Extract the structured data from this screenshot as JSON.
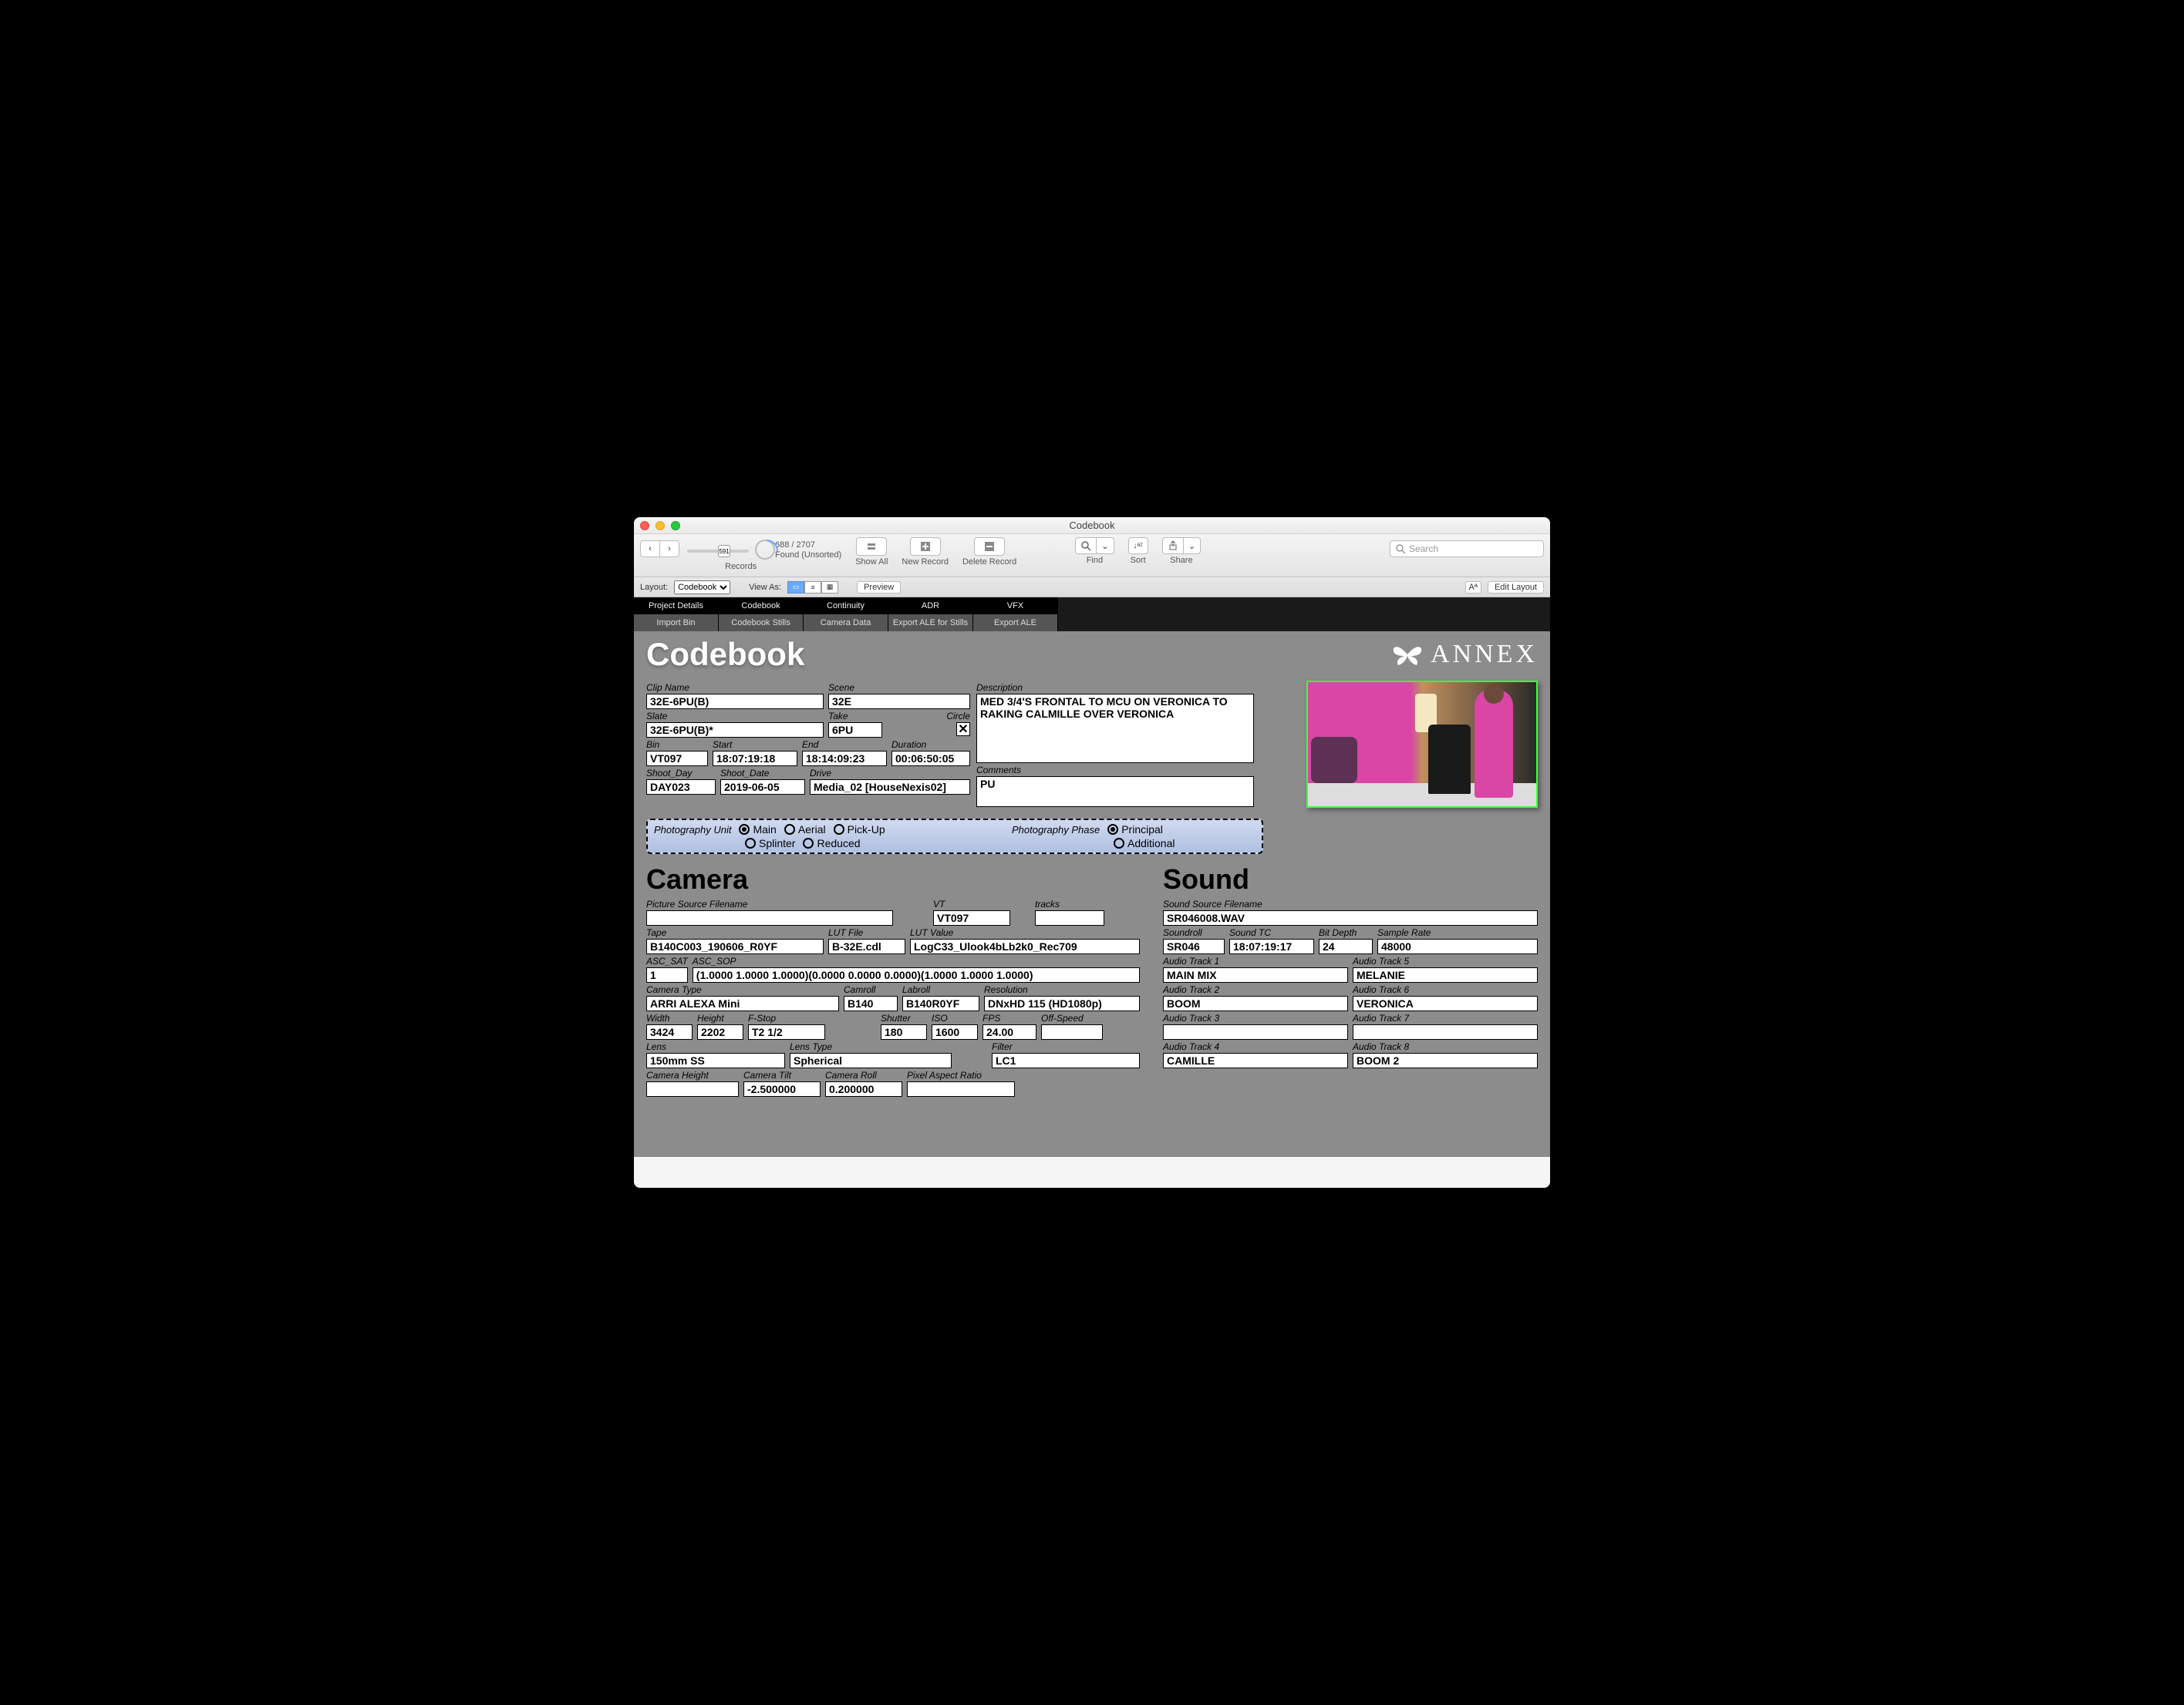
{
  "window": {
    "title": "Codebook"
  },
  "toolbar": {
    "nav_prev": "‹",
    "nav_next": "›",
    "slider_value": "591",
    "found_count": "688 / 2707",
    "found_status": "Found (Unsorted)",
    "records_label": "Records",
    "show_all": "Show All",
    "new_record": "New Record",
    "delete_record": "Delete Record",
    "find": "Find",
    "sort": "Sort",
    "share": "Share",
    "search_placeholder": "Search"
  },
  "layoutbar": {
    "layout_label": "Layout:",
    "layout_value": "Codebook",
    "viewas_label": "View As:",
    "preview": "Preview",
    "aa": "Aª",
    "edit_layout": "Edit Layout"
  },
  "tabs_primary": [
    "Project Details",
    "Codebook",
    "Continuity",
    "ADR",
    "VFX"
  ],
  "tabs_secondary": [
    "Import Bin",
    "Codebook Stills",
    "Camera Data",
    "Export ALE for Stills",
    "Export ALE"
  ],
  "header": {
    "title": "Codebook",
    "brand": "ANNEX"
  },
  "clip": {
    "clip_name_label": "Clip Name",
    "clip_name": "32E-6PU(B)",
    "scene_label": "Scene",
    "scene": "32E",
    "slate_label": "Slate",
    "slate": "32E-6PU(B)*",
    "take_label": "Take",
    "take": "6PU",
    "circle_label": "Circle",
    "circle_checked": "✕",
    "bin_label": "Bin",
    "bin": "VT097",
    "start_label": "Start",
    "start": "18:07:19:18",
    "end_label": "End",
    "end": "18:14:09:23",
    "duration_label": "Duration",
    "duration": "00:06:50:05",
    "shoot_day_label": "Shoot_Day",
    "shoot_day": "DAY023",
    "shoot_date_label": "Shoot_Date",
    "shoot_date": "2019-06-05",
    "drive_label": "Drive",
    "drive": "Media_02 [HouseNexis02]",
    "description_label": "Description",
    "description": "MED 3/4'S FRONTAL TO MCU ON VERONICA TO RAKING CALMILLE OVER VERONICA",
    "comments_label": "Comments",
    "comments": "PU"
  },
  "radios": {
    "unit_label": "Photography Unit",
    "unit_options": [
      "Main",
      "Aerial",
      "Pick-Up",
      "Splinter",
      "Reduced"
    ],
    "unit_selected": "Main",
    "phase_label": "Photography Phase",
    "phase_options": [
      "Principal",
      "Additional"
    ],
    "phase_selected": "Principal"
  },
  "camera": {
    "heading": "Camera",
    "psf_label": "Picture Source Filename",
    "psf": "",
    "vt_label": "VT",
    "vt": "VT097",
    "tracks_label": "tracks",
    "tracks": "",
    "tape_label": "Tape",
    "tape": "B140C003_190606_R0YF",
    "lutfile_label": "LUT File",
    "lutfile": "B-32E.cdl",
    "lutvalue_label": "LUT Value",
    "lutvalue": "LogC33_Ulook4bLb2k0_Rec709",
    "ascsat_label": "ASC_SAT",
    "ascsat": "1",
    "ascsop_label": "ASC_SOP",
    "ascsop": "(1.0000 1.0000 1.0000)(0.0000 0.0000 0.0000)(1.0000 1.0000 1.0000)",
    "camtype_label": "Camera Type",
    "camtype": "ARRI ALEXA Mini",
    "camroll_label": "Camroll",
    "camroll": "B140",
    "labroll_label": "Labroll",
    "labroll": "B140R0YF",
    "res_label": "Resolution",
    "res": "DNxHD 115 (HD1080p)",
    "width_label": "Width",
    "width": "3424",
    "height_label": "Height",
    "height": "2202",
    "fstop_label": "F-Stop",
    "fstop": "T2 1/2",
    "shutter_label": "Shutter",
    "shutter": "180",
    "iso_label": "ISO",
    "iso": "1600",
    "fps_label": "FPS",
    "fps": "24.00",
    "offspeed_label": "Off-Speed",
    "offspeed": "",
    "lens_label": "Lens",
    "lens": "150mm SS",
    "lenstype_label": "Lens Type",
    "lenstype": "Spherical",
    "filter_label": "Filter",
    "filter": "LC1",
    "camheight_label": "Camera Height",
    "camheight": "",
    "camtilt_label": "Camera Tilt",
    "camtilt": "-2.500000",
    "camroll2_label": "Camera Roll",
    "camroll2": "0.200000",
    "par_label": "Pixel Aspect Ratio",
    "par": ""
  },
  "sound": {
    "heading": "Sound",
    "ssf_label": "Sound Source Filename",
    "ssf": "SR046008.WAV",
    "soundroll_label": "Soundroll",
    "soundroll": "SR046",
    "soundtc_label": "Sound TC",
    "soundtc": "18:07:19:17",
    "bitdepth_label": "Bit Depth",
    "bitdepth": "24",
    "samplerate_label": "Sample Rate",
    "samplerate": "48000",
    "t1_label": "Audio Track 1",
    "t1": "MAIN MIX",
    "t2_label": "Audio Track 2",
    "t2": "BOOM",
    "t3_label": "Audio Track 3",
    "t3": "",
    "t4_label": "Audio Track 4",
    "t4": "CAMILLE",
    "t5_label": "Audio Track 5",
    "t5": "MELANIE",
    "t6_label": "Audio Track 6",
    "t6": "VERONICA",
    "t7_label": "Audio Track 7",
    "t7": "",
    "t8_label": "Audio Track 8",
    "t8": "BOOM 2"
  }
}
